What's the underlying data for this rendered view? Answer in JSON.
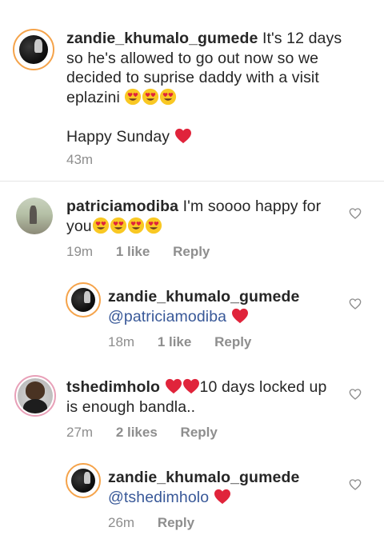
{
  "caption": {
    "username": "zandie_khumalo_gumede",
    "text": "It's 12 days so he's allowed to go out now so we decided to suprise daddy with a visit eplazini",
    "text_line2": "Happy Sunday",
    "time": "43m"
  },
  "comments": [
    {
      "username": "patriciamodiba",
      "text": "I'm soooo happy for you",
      "time": "19m",
      "likes": "1 like",
      "reply": "Reply"
    },
    {
      "username": "zandie_khumalo_gumede",
      "mention": "@patriciamodiba",
      "time": "18m",
      "likes": "1 like",
      "reply": "Reply"
    },
    {
      "username": "tshedimholo",
      "text": "10 days locked up is enough bandla..",
      "time": "27m",
      "likes": "2 likes",
      "reply": "Reply"
    },
    {
      "username": "zandie_khumalo_gumede",
      "mention": "@tshedimholo",
      "time": "26m",
      "reply": "Reply"
    }
  ],
  "icons": {
    "like": "heart-outline-icon",
    "red_heart": "red-heart-emoji",
    "heart_eyes": "heart-eyes-emoji"
  },
  "colors": {
    "heart_red": "#e0243b",
    "meta_gray": "#8e8e8e",
    "mention_blue": "#385898",
    "story_ring": "#f5a34a"
  }
}
